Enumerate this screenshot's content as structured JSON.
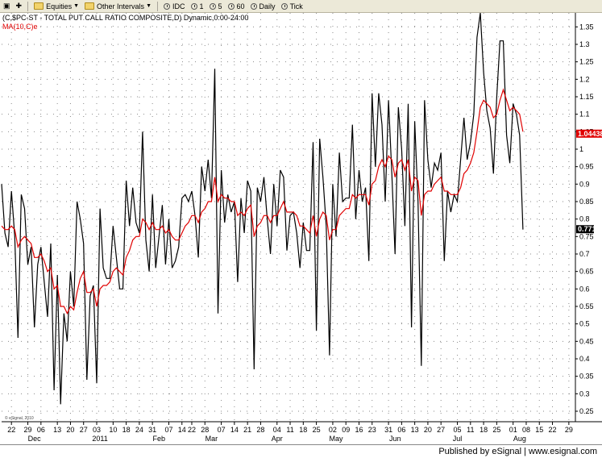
{
  "toolbar": {
    "items": [
      {
        "label": "▣",
        "icon": "window-menu-icon"
      },
      {
        "label": "✚",
        "icon": "crosshair-icon"
      },
      {
        "label": "Equities",
        "icon": "folder-icon",
        "dropdown": true
      },
      {
        "label": "Other Intervals",
        "icon": "folder-icon",
        "dropdown": true
      },
      {
        "label": "IDC",
        "icon": "clock-icon"
      },
      {
        "label": "1",
        "icon": "clock-icon"
      },
      {
        "label": "5",
        "icon": "clock-icon"
      },
      {
        "label": "60",
        "icon": "clock-icon"
      },
      {
        "label": "Daily",
        "icon": "clock-icon"
      },
      {
        "label": "Tick",
        "icon": "clock-icon"
      }
    ]
  },
  "footer": {
    "text": "Published by eSignal | www.esignal.com"
  },
  "colors": {
    "price_line": "#000000",
    "ma_line": "#e00000",
    "grid": "#8a8a8a"
  },
  "chart_data": {
    "type": "line",
    "title": "(C,$PC-ST - TOTAL PUT CALL RATIO COMPOSITE,D) Dynamic,0:00-24:00",
    "ma_label": "MA(10,C)e",
    "watermark": "© eSignal, 2010",
    "last_price_label": "0.771",
    "last_ma_label": "1.04438",
    "ylim": [
      0.22,
      1.39
    ],
    "yticks": [
      0.25,
      0.3,
      0.35,
      0.4,
      0.45,
      0.5,
      0.55,
      0.6,
      0.65,
      0.7,
      0.75,
      0.8,
      0.85,
      0.9,
      0.95,
      1.0,
      1.05,
      1.1,
      1.15,
      1.2,
      1.25,
      1.3,
      1.35
    ],
    "ytick_labels": [
      "0.25",
      "0.3",
      "0.35",
      "0.4",
      "0.45",
      "0.5",
      "0.55",
      "0.6",
      "0.65",
      "0.7",
      "0.75",
      "0.8",
      "0.85",
      "0.9",
      "0.95",
      "1",
      "1.05",
      "1.1",
      "1.15",
      "1.2",
      "1.25",
      "1.3",
      "1.35"
    ],
    "xlim": [
      0,
      175
    ],
    "x_day_ticks": [
      {
        "i": 3,
        "label": "22"
      },
      {
        "i": 8,
        "label": "29"
      },
      {
        "i": 12,
        "label": "06"
      },
      {
        "i": 17,
        "label": "13"
      },
      {
        "i": 21,
        "label": "20"
      },
      {
        "i": 25,
        "label": "27"
      },
      {
        "i": 29,
        "label": "03"
      },
      {
        "i": 34,
        "label": "10"
      },
      {
        "i": 38,
        "label": "18"
      },
      {
        "i": 42,
        "label": "24"
      },
      {
        "i": 46,
        "label": "31"
      },
      {
        "i": 51,
        "label": "07"
      },
      {
        "i": 55,
        "label": "14"
      },
      {
        "i": 58,
        "label": "22"
      },
      {
        "i": 62,
        "label": "28"
      },
      {
        "i": 67,
        "label": "07"
      },
      {
        "i": 71,
        "label": "14"
      },
      {
        "i": 75,
        "label": "21"
      },
      {
        "i": 79,
        "label": "28"
      },
      {
        "i": 84,
        "label": "04"
      },
      {
        "i": 88,
        "label": "11"
      },
      {
        "i": 92,
        "label": "18"
      },
      {
        "i": 96,
        "label": "25"
      },
      {
        "i": 101,
        "label": "02"
      },
      {
        "i": 105,
        "label": "09"
      },
      {
        "i": 109,
        "label": "16"
      },
      {
        "i": 113,
        "label": "23"
      },
      {
        "i": 118,
        "label": "31"
      },
      {
        "i": 122,
        "label": "06"
      },
      {
        "i": 126,
        "label": "13"
      },
      {
        "i": 130,
        "label": "20"
      },
      {
        "i": 134,
        "label": "27"
      },
      {
        "i": 139,
        "label": "05"
      },
      {
        "i": 143,
        "label": "11"
      },
      {
        "i": 147,
        "label": "18"
      },
      {
        "i": 151,
        "label": "25"
      },
      {
        "i": 156,
        "label": "01"
      },
      {
        "i": 160,
        "label": "08"
      },
      {
        "i": 164,
        "label": "15"
      },
      {
        "i": 168,
        "label": "22"
      },
      {
        "i": 173,
        "label": "29"
      }
    ],
    "x_month_ticks": [
      {
        "i": 10,
        "label": "Dec"
      },
      {
        "i": 30,
        "label": "2011"
      },
      {
        "i": 48,
        "label": "Feb"
      },
      {
        "i": 64,
        "label": "Mar"
      },
      {
        "i": 84,
        "label": "Apr"
      },
      {
        "i": 102,
        "label": "May"
      },
      {
        "i": 120,
        "label": "Jun"
      },
      {
        "i": 139,
        "label": "Jul"
      },
      {
        "i": 158,
        "label": "Aug"
      }
    ],
    "series": [
      {
        "name": "C,$PC-ST",
        "values": [
          0.9,
          0.76,
          0.72,
          0.88,
          0.75,
          0.46,
          0.87,
          0.83,
          0.67,
          0.72,
          0.49,
          0.67,
          0.72,
          0.62,
          0.52,
          0.73,
          0.31,
          0.64,
          0.27,
          0.53,
          0.45,
          0.65,
          0.55,
          0.85,
          0.8,
          0.73,
          0.34,
          0.58,
          0.61,
          0.33,
          0.83,
          0.66,
          0.63,
          0.63,
          0.78,
          0.69,
          0.6,
          0.6,
          0.91,
          0.78,
          0.89,
          0.79,
          0.76,
          1.05,
          0.74,
          0.65,
          0.87,
          0.66,
          0.75,
          0.84,
          0.67,
          0.8,
          0.66,
          0.68,
          0.72,
          0.86,
          0.87,
          0.85,
          0.88,
          0.81,
          0.69,
          0.95,
          0.88,
          0.97,
          0.86,
          1.23,
          0.53,
          0.94,
          0.79,
          0.87,
          0.82,
          0.85,
          0.62,
          0.86,
          0.76,
          0.91,
          0.88,
          0.37,
          0.89,
          0.85,
          0.92,
          0.8,
          0.7,
          0.9,
          0.78,
          0.94,
          0.92,
          0.71,
          0.81,
          0.82,
          0.76,
          0.66,
          0.79,
          0.71,
          0.71,
          1.02,
          0.48,
          1.03,
          0.92,
          0.78,
          0.41,
          0.9,
          0.75,
          0.99,
          0.85,
          0.86,
          0.86,
          1.07,
          0.8,
          0.94,
          0.85,
          0.89,
          0.68,
          1.16,
          0.95,
          1.16,
          1.07,
          0.85,
          1.14,
          0.93,
          0.7,
          1.12,
          1.0,
          0.78,
          1.13,
          0.49,
          1.08,
          0.85,
          0.38,
          1.14,
          0.97,
          0.89,
          0.96,
          0.94,
          0.99,
          0.68,
          0.88,
          0.82,
          0.87,
          0.85,
          0.97,
          1.09,
          0.97,
          1.02,
          1.1,
          1.32,
          1.4,
          1.22,
          1.11,
          1.06,
          0.93,
          1.15,
          1.31,
          1.31,
          1.04,
          0.96,
          1.13,
          1.1,
          1.04,
          0.77
        ]
      },
      {
        "name": "MA(10,C)e",
        "values": [
          0.78,
          0.77,
          0.77,
          0.78,
          0.77,
          0.72,
          0.74,
          0.75,
          0.74,
          0.73,
          0.69,
          0.69,
          0.7,
          0.68,
          0.65,
          0.66,
          0.6,
          0.61,
          0.55,
          0.55,
          0.53,
          0.55,
          0.54,
          0.59,
          0.63,
          0.65,
          0.59,
          0.59,
          0.6,
          0.55,
          0.6,
          0.61,
          0.61,
          0.62,
          0.65,
          0.66,
          0.65,
          0.64,
          0.69,
          0.71,
          0.74,
          0.75,
          0.75,
          0.8,
          0.79,
          0.77,
          0.79,
          0.77,
          0.77,
          0.78,
          0.76,
          0.77,
          0.75,
          0.74,
          0.74,
          0.76,
          0.78,
          0.79,
          0.81,
          0.81,
          0.79,
          0.82,
          0.83,
          0.85,
          0.85,
          0.92,
          0.85,
          0.87,
          0.86,
          0.86,
          0.85,
          0.85,
          0.81,
          0.82,
          0.81,
          0.83,
          0.84,
          0.75,
          0.78,
          0.79,
          0.81,
          0.81,
          0.79,
          0.81,
          0.81,
          0.83,
          0.85,
          0.82,
          0.82,
          0.82,
          0.81,
          0.78,
          0.78,
          0.77,
          0.76,
          0.81,
          0.75,
          0.8,
          0.82,
          0.81,
          0.74,
          0.77,
          0.77,
          0.81,
          0.82,
          0.83,
          0.83,
          0.87,
          0.86,
          0.87,
          0.87,
          0.87,
          0.84,
          0.9,
          0.91,
          0.95,
          0.97,
          0.95,
          0.98,
          0.97,
          0.92,
          0.96,
          0.97,
          0.94,
          0.97,
          0.88,
          0.92,
          0.91,
          0.81,
          0.87,
          0.88,
          0.88,
          0.9,
          0.91,
          0.92,
          0.88,
          0.88,
          0.87,
          0.87,
          0.87,
          0.89,
          0.93,
          0.94,
          0.96,
          0.99,
          1.05,
          1.12,
          1.14,
          1.13,
          1.12,
          1.09,
          1.1,
          1.14,
          1.17,
          1.14,
          1.11,
          1.12,
          1.11,
          1.1,
          1.05
        ]
      }
    ]
  }
}
